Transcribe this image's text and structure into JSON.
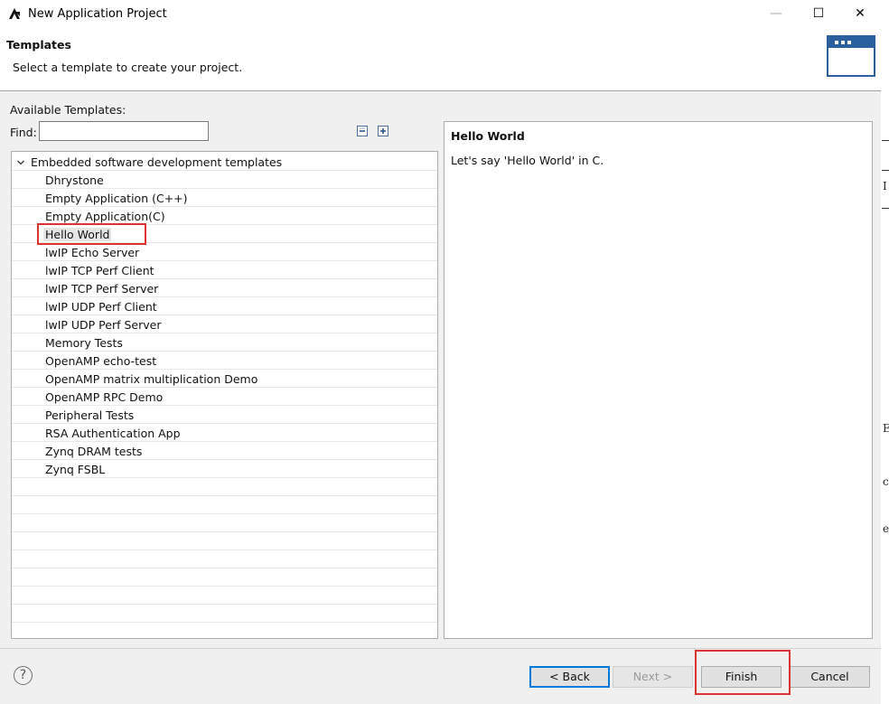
{
  "window": {
    "title": "New Application Project",
    "controls": {
      "minimize": "—",
      "maximize": "☐",
      "close": "✕"
    }
  },
  "header": {
    "title": "Templates",
    "description": "Select a template to create your project."
  },
  "templates": {
    "available_label": "Available Templates:",
    "find_label": "Find:",
    "find_value": "",
    "category": "Embedded software development templates",
    "items": [
      "Dhrystone",
      "Empty Application (C++)",
      "Empty Application(C)",
      "Hello World",
      "lwIP Echo Server",
      "lwIP TCP Perf Client",
      "lwIP TCP Perf Server",
      "lwIP UDP Perf Client",
      "lwIP UDP Perf Server",
      "Memory Tests",
      "OpenAMP echo-test",
      "OpenAMP matrix multiplication Demo",
      "OpenAMP RPC Demo",
      "Peripheral Tests",
      "RSA Authentication App",
      "Zynq DRAM tests",
      "Zynq FSBL"
    ],
    "selected": "Hello World"
  },
  "description_panel": {
    "title": "Hello World",
    "text": "Let's say 'Hello World' in C."
  },
  "buttons": {
    "help": "?",
    "back": "< Back",
    "next": "Next >",
    "finish": "Finish",
    "cancel": "Cancel"
  },
  "background_edge": {
    "glyphs": [
      "I",
      "E",
      "c",
      "e"
    ]
  },
  "colors": {
    "highlight": "#e03131",
    "wizard_icon": "#2b5f9e",
    "default_button_border": "#0078d7"
  },
  "icons": {
    "app": "amd-logo-icon",
    "collapse_all": "collapse-all-icon",
    "expand_all": "expand-all-icon",
    "tree_toggle": "chevron-down-icon",
    "wizard_banner": "application-window-icon",
    "help": "help-icon"
  }
}
